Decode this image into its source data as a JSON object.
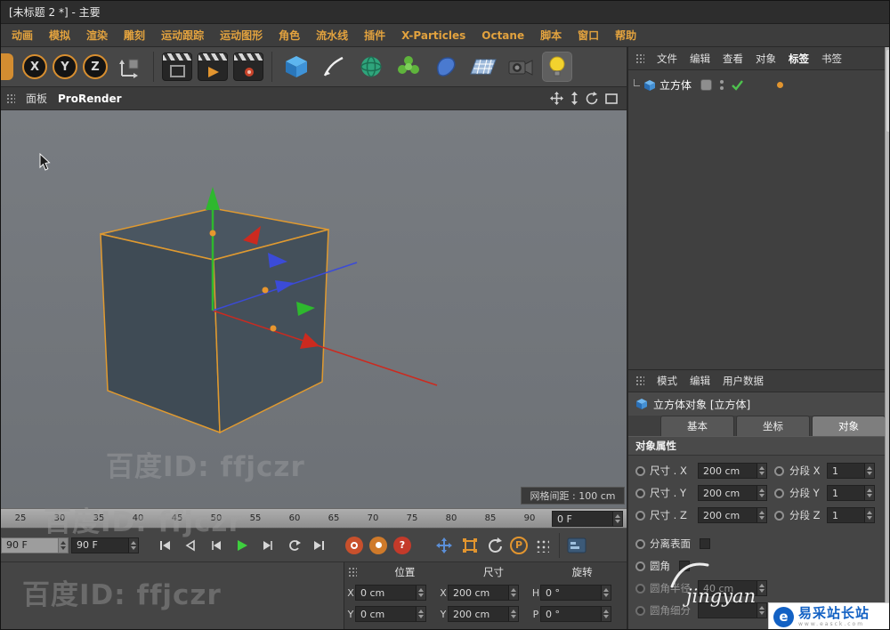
{
  "window": {
    "title": "[未标题 2 *] - 主要"
  },
  "menubar": {
    "items": [
      "动画",
      "模拟",
      "渲染",
      "雕刻",
      "运动跟踪",
      "运动图形",
      "角色",
      "流水线",
      "插件",
      "X-Particles",
      "Octane",
      "脚本",
      "窗口",
      "帮助"
    ]
  },
  "toolbar": {
    "axis": [
      "X",
      "Y",
      "Z"
    ]
  },
  "viewport": {
    "tab_panel": "面板",
    "tab_prorender": "ProRender",
    "grid_label": "网格间距 : 100 cm"
  },
  "timeline": {
    "ticks": [
      "25",
      "30",
      "35",
      "40",
      "45",
      "50",
      "55",
      "60",
      "65",
      "70",
      "75",
      "80",
      "85",
      "90"
    ],
    "current": "0 F",
    "range_start": "90 F",
    "range_end": "90 F"
  },
  "transport": {
    "p": "P",
    "q": "?"
  },
  "coord": {
    "headers": {
      "pos": "位置",
      "size": "尺寸",
      "rot": "旋转"
    },
    "rows": [
      {
        "pl": "X",
        "pv": "0 cm",
        "sl": "X",
        "sv": "200 cm",
        "rl": "H",
        "rv": "0 °"
      },
      {
        "pl": "Y",
        "pv": "0 cm",
        "sl": "Y",
        "sv": "200 cm",
        "rl": "P",
        "rv": "0 °"
      }
    ]
  },
  "object_manager": {
    "menu": [
      "文件",
      "编辑",
      "查看",
      "对象",
      "标签",
      "书签"
    ],
    "object_name": "立方体"
  },
  "attributes": {
    "menu": [
      "模式",
      "编辑",
      "用户数据"
    ],
    "title": "立方体对象 [立方体]",
    "tabs": [
      "基本",
      "坐标",
      "对象"
    ],
    "section": "对象属性",
    "rows": [
      {
        "label": "尺寸 . X",
        "value": "200 cm",
        "label2": "分段 X",
        "value2": "1"
      },
      {
        "label": "尺寸 . Y",
        "value": "200 cm",
        "label2": "分段 Y",
        "value2": "1"
      },
      {
        "label": "尺寸 . Z",
        "value": "200 cm",
        "label2": "分段 Z",
        "value2": "1"
      }
    ],
    "check_rows": [
      {
        "label": "分离表面"
      },
      {
        "label": "圆角"
      }
    ],
    "dim_rows": [
      {
        "label": "圆角半径",
        "value": "40 cm"
      },
      {
        "label": "圆角细分",
        "value": ""
      }
    ]
  },
  "watermarks": {
    "baidu": "百度ID: ffjczr",
    "jingyan": "jingyan",
    "site": "易采站长站",
    "site_icon": "e",
    "site_sub": "www.easck.com"
  }
}
